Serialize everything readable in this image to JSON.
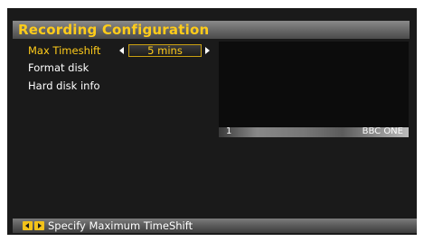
{
  "header": {
    "title": "Recording Configuration"
  },
  "menu": {
    "items": [
      {
        "label": "Max Timeshift",
        "selected": true,
        "value": "5 mins"
      },
      {
        "label": "Format disk",
        "selected": false
      },
      {
        "label": "Hard disk info",
        "selected": false
      }
    ]
  },
  "preview": {
    "channel_number": "1",
    "channel_name": "BBC ONE"
  },
  "footer": {
    "hint": "Specify Maximum TimeShift",
    "icons": [
      "left-key-icon",
      "right-key-icon"
    ]
  },
  "colors": {
    "accent": "#ffcc1a",
    "background": "#1a1a1a",
    "text": "#ffffff"
  }
}
